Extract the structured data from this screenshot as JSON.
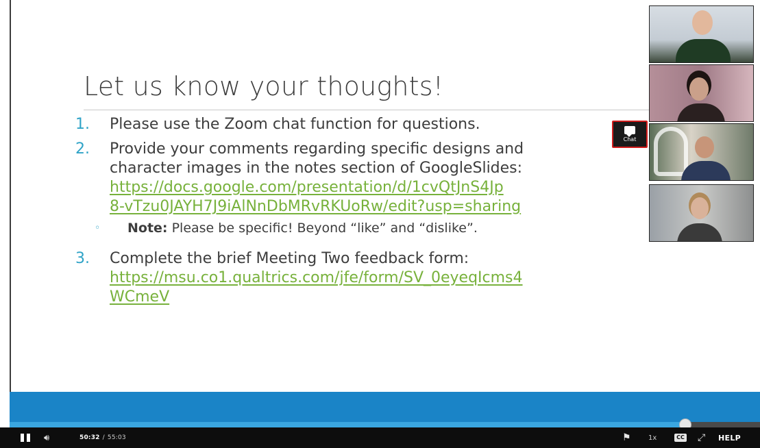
{
  "slide": {
    "title": "Let us know your thoughts!",
    "items": [
      {
        "number": "1.",
        "text": "Please use the Zoom chat function for questions."
      },
      {
        "number": "2.",
        "text_line1": "Provide your comments regarding specific designs and",
        "text_line2": "character images in the notes section of GoogleSlides:",
        "link_line1": "https://docs.google.com/presentation/d/1cvQtJnS4Jp",
        "link_line2": "8-vTzu0JAYH7J9iAlNnDbMRvRKUoRw/edit?usp=sharing",
        "note": {
          "label": "Note:",
          "text": "Please be specific! Beyond “like” and “dislike”."
        }
      },
      {
        "number": "3.",
        "text": "Complete the brief Meeting Two feedback form:",
        "link_line1": "https://msu.co1.qualtrics.com/jfe/form/SV_0eyeqIcms4",
        "link_line2": "WCmeV"
      }
    ]
  },
  "chat_badge": {
    "label": "Chat",
    "icon": "chat-bubble-icon",
    "border_color": "#d11b1b"
  },
  "participants": [
    {
      "tile": "participant-video-1"
    },
    {
      "tile": "participant-video-2"
    },
    {
      "tile": "participant-video-3"
    },
    {
      "tile": "participant-video-4"
    }
  ],
  "player": {
    "current_time": "50:32",
    "separator": "/",
    "total_time": "55:03",
    "progress": 0.9,
    "speed": "1x",
    "cc_label": "CC",
    "help_label": "HELP",
    "accent_color": "#1a84c7",
    "icons": {
      "play_pause": "pause-icon",
      "volume": "volume-icon",
      "bookmark": "flag-icon",
      "captions": "cc-icon",
      "fullscreen": "fullscreen-icon"
    }
  }
}
